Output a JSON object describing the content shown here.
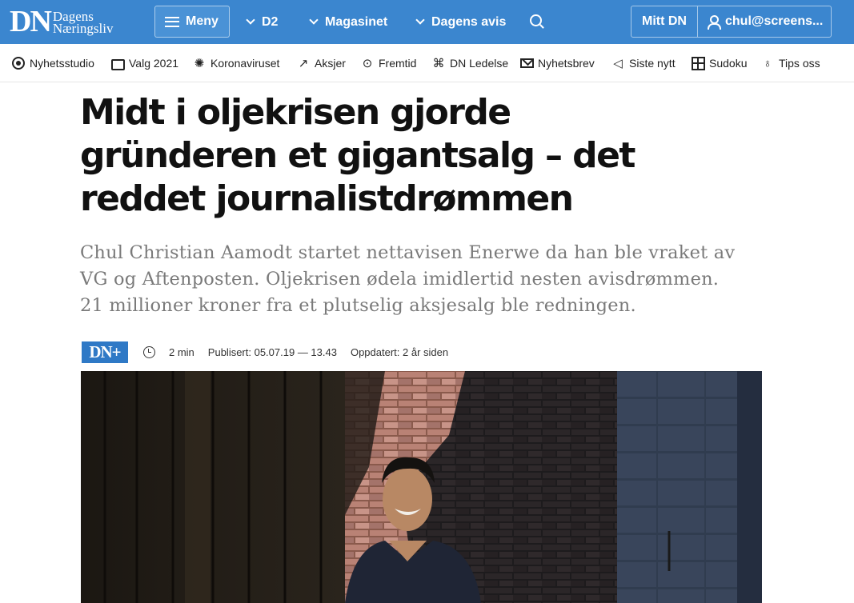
{
  "header": {
    "logo_dn": "DN",
    "logo_line1": "Dagens",
    "logo_line2": "Næringsliv",
    "menu_label": "Meny",
    "nav": [
      "D2",
      "Magasinet",
      "Dagens avis"
    ],
    "account_label": "Mitt DN",
    "user_label": "chul@screens..."
  },
  "subnav": {
    "items": [
      {
        "label": "Nyhetsstudio",
        "icon": "record-icon"
      },
      {
        "label": "Valg 2021",
        "icon": "ballot-box-icon"
      },
      {
        "label": "Koronaviruset",
        "icon": "virus-icon"
      },
      {
        "label": "Aksjer",
        "icon": "chart-line-icon"
      },
      {
        "label": "Fremtid",
        "icon": "forward-icon"
      },
      {
        "label": "DN Ledelse",
        "icon": "org-chart-icon"
      },
      {
        "label": "Nyhetsbrev",
        "icon": "envelope-icon"
      },
      {
        "label": "Siste nytt",
        "icon": "megaphone-icon"
      },
      {
        "label": "Sudoku",
        "icon": "grid-icon"
      },
      {
        "label": "Tips oss",
        "icon": "lightbulb-icon"
      }
    ]
  },
  "article": {
    "headline_lines": [
      "Midt i oljekrisen gjorde",
      "gründeren et gigantsalg – det",
      "reddet journalistdrømmen"
    ],
    "lede_lines": [
      "Chul Christian Aamodt startet nettavisen Enerwe da han ble vraket av",
      "VG og Aftenposten. Oljekrisen ødela imidlertid nesten avisdrømmen.",
      "21 millioner kroner fra et plutselig aksjesalg ble redningen."
    ],
    "badge": "DN+",
    "read_time": "2 min",
    "published": "Publisert: 05.07.19 — 13.43",
    "updated": "Oppdatert: 2 år siden"
  },
  "colors": {
    "brand_blue": "#3b86cf",
    "dnplus_blue": "#2f79c6",
    "lede_gray": "#7a7a7a"
  }
}
